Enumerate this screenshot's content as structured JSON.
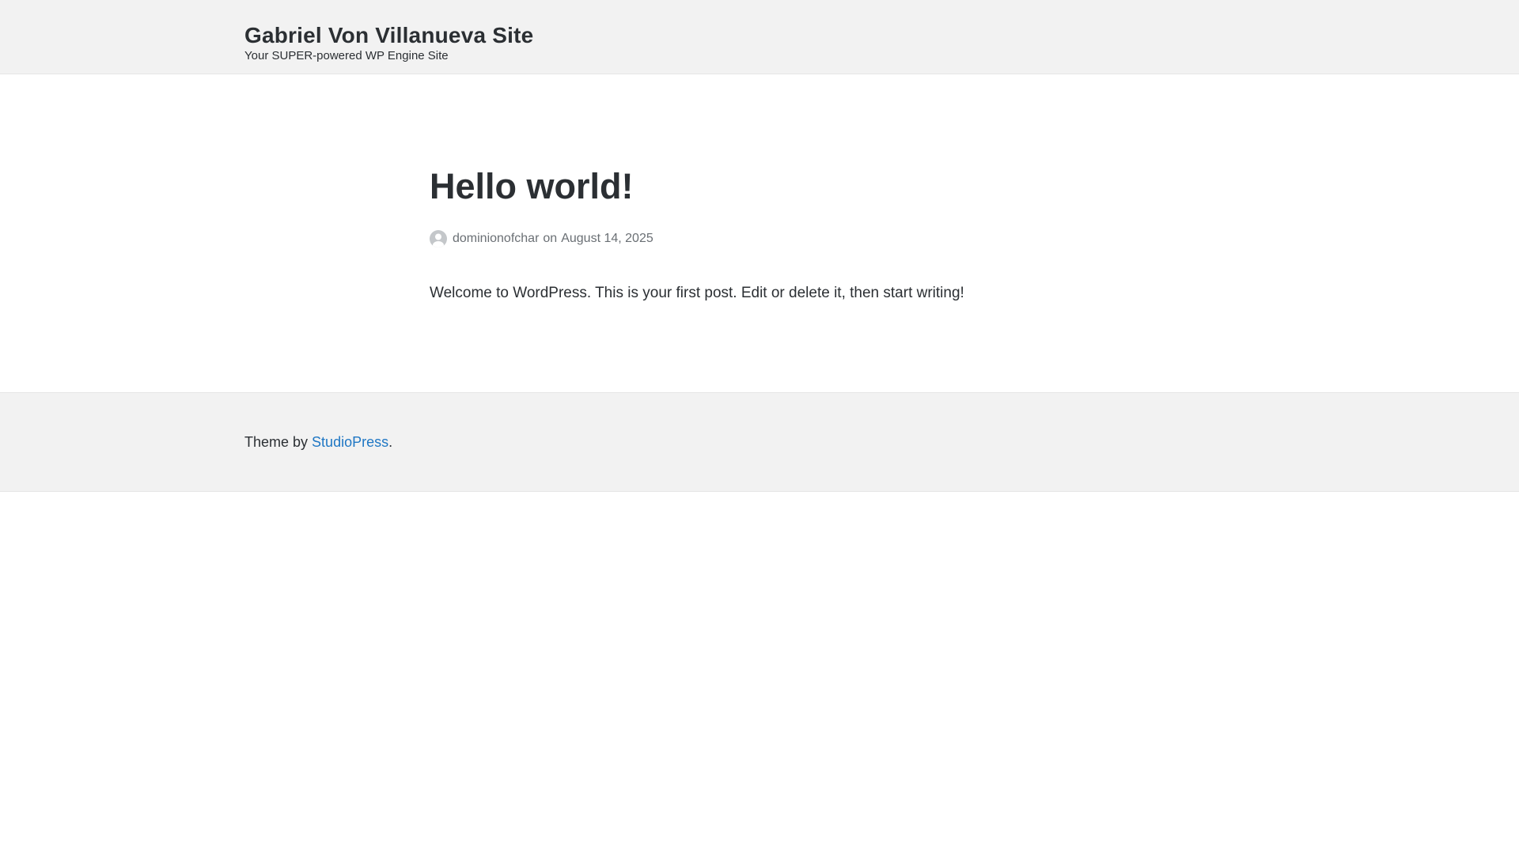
{
  "header": {
    "site_title": "Gabriel Von Villanueva Site",
    "tagline": "Your SUPER-powered WP Engine Site"
  },
  "post": {
    "title": "Hello world!",
    "author_icon": "avatar-icon",
    "author": "dominionofchar",
    "separator": "on",
    "date": "August 14, 2025",
    "content": "Welcome to WordPress. This is your first post. Edit or delete it, then start writing!"
  },
  "footer": {
    "prefix": "Theme by ",
    "link_label": "StudioPress",
    "suffix": "."
  },
  "colors": {
    "header_bg": "#f2f2f2",
    "text": "#2b2f33",
    "meta_text": "#6a6f74",
    "link": "#1f77c4"
  }
}
